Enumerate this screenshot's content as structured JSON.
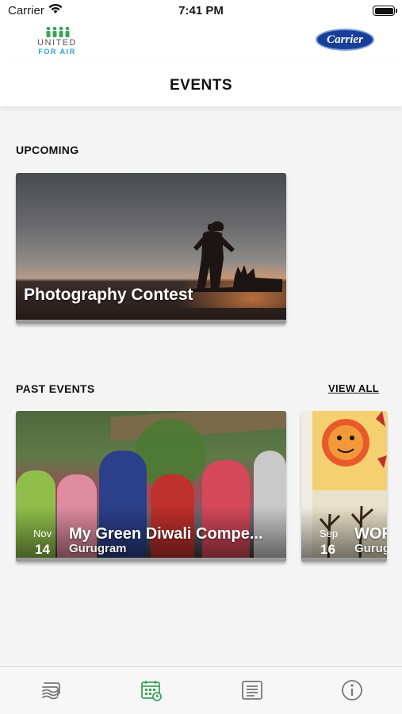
{
  "status_bar": {
    "carrier": "Carrier",
    "time": "7:41 PM"
  },
  "brand": {
    "left_logo_line1": "UNITED",
    "left_logo_line2": "FOR AIR",
    "right_logo": "Carrier"
  },
  "header": {
    "title": "EVENTS"
  },
  "upcoming": {
    "section_label": "UPCOMING",
    "events": [
      {
        "title": "Photography Contest"
      }
    ]
  },
  "past": {
    "section_label": "PAST EVENTS",
    "view_all_label": "VIEW ALL",
    "events": [
      {
        "month": "Nov",
        "day": "14",
        "title": "My Green Diwali Compe...",
        "location": "Gurugram"
      },
      {
        "month": "Sep",
        "day": "16",
        "title": "WOR",
        "location": "Gurug"
      }
    ]
  },
  "tabs": [
    {
      "icon": "air-layers-icon",
      "active": false
    },
    {
      "icon": "calendar-clock-icon",
      "active": true
    },
    {
      "icon": "news-list-icon",
      "active": false
    },
    {
      "icon": "info-icon",
      "active": false
    }
  ],
  "colors": {
    "active_tab": "#3aa35a",
    "inactive_tab": "#777777",
    "carrier_blue": "#1a3f99",
    "ufa_blue": "#2aa0d8",
    "ufa_green": "#3aa35a"
  }
}
